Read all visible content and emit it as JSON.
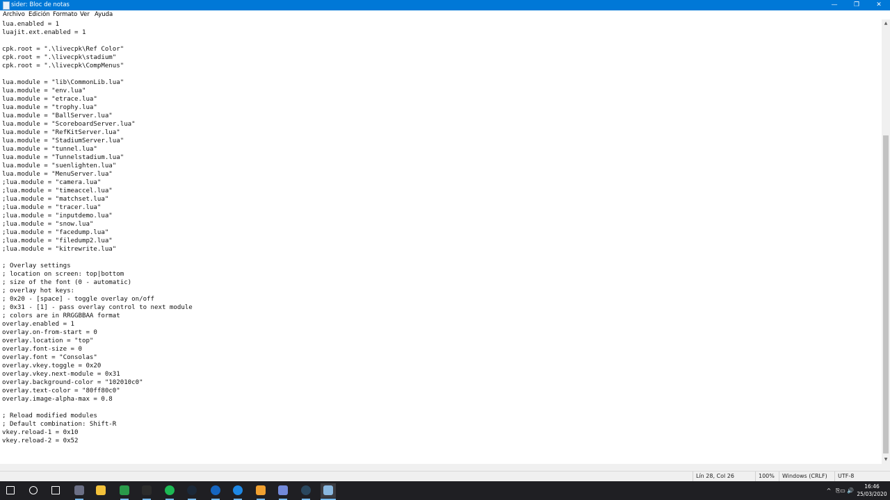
{
  "window": {
    "title": "sider: Bloc de notas",
    "icon": "notepad-icon",
    "controls": [
      "—",
      "❐",
      "✕"
    ]
  },
  "menu": [
    "Archivo",
    "Edición",
    "Formato",
    "Ver",
    "Ayuda"
  ],
  "editor": {
    "lines": [
      "lua.enabled = 1",
      "luajit.ext.enabled = 1",
      "",
      "cpk.root = \".\\livecpk\\Ref Color\"",
      "cpk.root = \".\\livecpk\\stadium\"",
      "cpk.root = \".\\livecpk\\CompMenus\"",
      "",
      "lua.module = \"lib\\CommonLib.lua\"",
      "lua.module = \"env.lua\"",
      "lua.module = \"etrace.lua\"",
      "lua.module = \"trophy.lua\"",
      "lua.module = \"BallServer.lua\"",
      "lua.module = \"ScoreboardServer.lua\"",
      "lua.module = \"RefKitServer.lua\"",
      "lua.module = \"StadiumServer.lua\"",
      "lua.module = \"tunnel.lua\"",
      "lua.module = \"Tunnelstadium.lua\"",
      "lua.module = \"suenlighten.lua\"",
      "lua.module = \"MenuServer.lua\"",
      ";lua.module = \"camera.lua\"",
      ";lua.module = \"timeaccel.lua\"",
      ";lua.module = \"matchset.lua\"",
      ";lua.module = \"tracer.lua\"",
      ";lua.module = \"inputdemo.lua\"",
      ";lua.module = \"snow.lua\"",
      ";lua.module = \"facedump.lua\"",
      ";lua.module = \"filedump2.lua\"",
      ";lua.module = \"kitrewrite.lua\"",
      "",
      "; Overlay settings",
      "; location on screen: top|bottom",
      "; size of the font (0 - automatic)",
      "; overlay hot keys:",
      "; 0x20 - [space] - toggle overlay on/off",
      "; 0x31 - [1] - pass overlay control to next module",
      "; colors are in RRGGBBAA format",
      "overlay.enabled = 1",
      "overlay.on-from-start = 0",
      "overlay.location = \"top\"",
      "overlay.font-size = 0",
      "overlay.font = \"Consolas\"",
      "overlay.vkey.toggle = 0x20",
      "overlay.vkey.next-module = 0x31",
      "overlay.background-color = \"102010c0\"",
      "overlay.text-color = \"80ff80c0\"",
      "overlay.image-alpha-max = 0.8",
      "",
      "; Reload modified modules",
      "; Default combination: Shift-R",
      "vkey.reload-1 = 0x10",
      "vkey.reload-2 = 0x52"
    ]
  },
  "status": {
    "position": "Lín 28, Col 26",
    "zoom": "100%",
    "line_endings": "Windows (CRLF)",
    "encoding": "UTF-8"
  },
  "taskbar": {
    "apps": [
      {
        "name": "start-button",
        "icon": "windows-logo-icon",
        "color": "#ffffff"
      },
      {
        "name": "search-button",
        "icon": "search-icon",
        "color": "#ffffff"
      },
      {
        "name": "task-view-button",
        "icon": "task-view-icon",
        "color": "#ffffff"
      },
      {
        "name": "taskbar-pes",
        "icon": "pes-icon",
        "color": "#6b6f85"
      },
      {
        "name": "taskbar-file-explorer",
        "icon": "folder-icon",
        "color": "#f3c13a"
      },
      {
        "name": "taskbar-game-app",
        "icon": "game-icon",
        "color": "#2a9a4a"
      },
      {
        "name": "taskbar-epic-games",
        "icon": "epic-games-icon",
        "color": "#2b2b2b"
      },
      {
        "name": "taskbar-spotify",
        "icon": "spotify-icon",
        "color": "#1db954"
      },
      {
        "name": "taskbar-steam",
        "icon": "steam-icon",
        "color": "#1b2838"
      },
      {
        "name": "taskbar-browser",
        "icon": "browser-icon",
        "color": "#1565c0"
      },
      {
        "name": "taskbar-edge",
        "icon": "edge-icon",
        "color": "#1e88e5"
      },
      {
        "name": "taskbar-app",
        "icon": "app-icon",
        "color": "#f0a030"
      },
      {
        "name": "taskbar-discord",
        "icon": "discord-icon",
        "color": "#7289da"
      },
      {
        "name": "taskbar-steam-2",
        "icon": "steam-icon",
        "color": "#2a475e"
      },
      {
        "name": "taskbar-notepad",
        "icon": "notepad-icon",
        "color": "#8ab8e0"
      }
    ],
    "tray_icons": [
      "^",
      "⎘",
      "▭",
      "🔊"
    ],
    "clock_time": "16:46",
    "clock_date": "25/03/2020"
  },
  "colors": {
    "titlebar": "#0078d7",
    "taskbar": "#1f1f23",
    "accent": "#76b9ed"
  }
}
